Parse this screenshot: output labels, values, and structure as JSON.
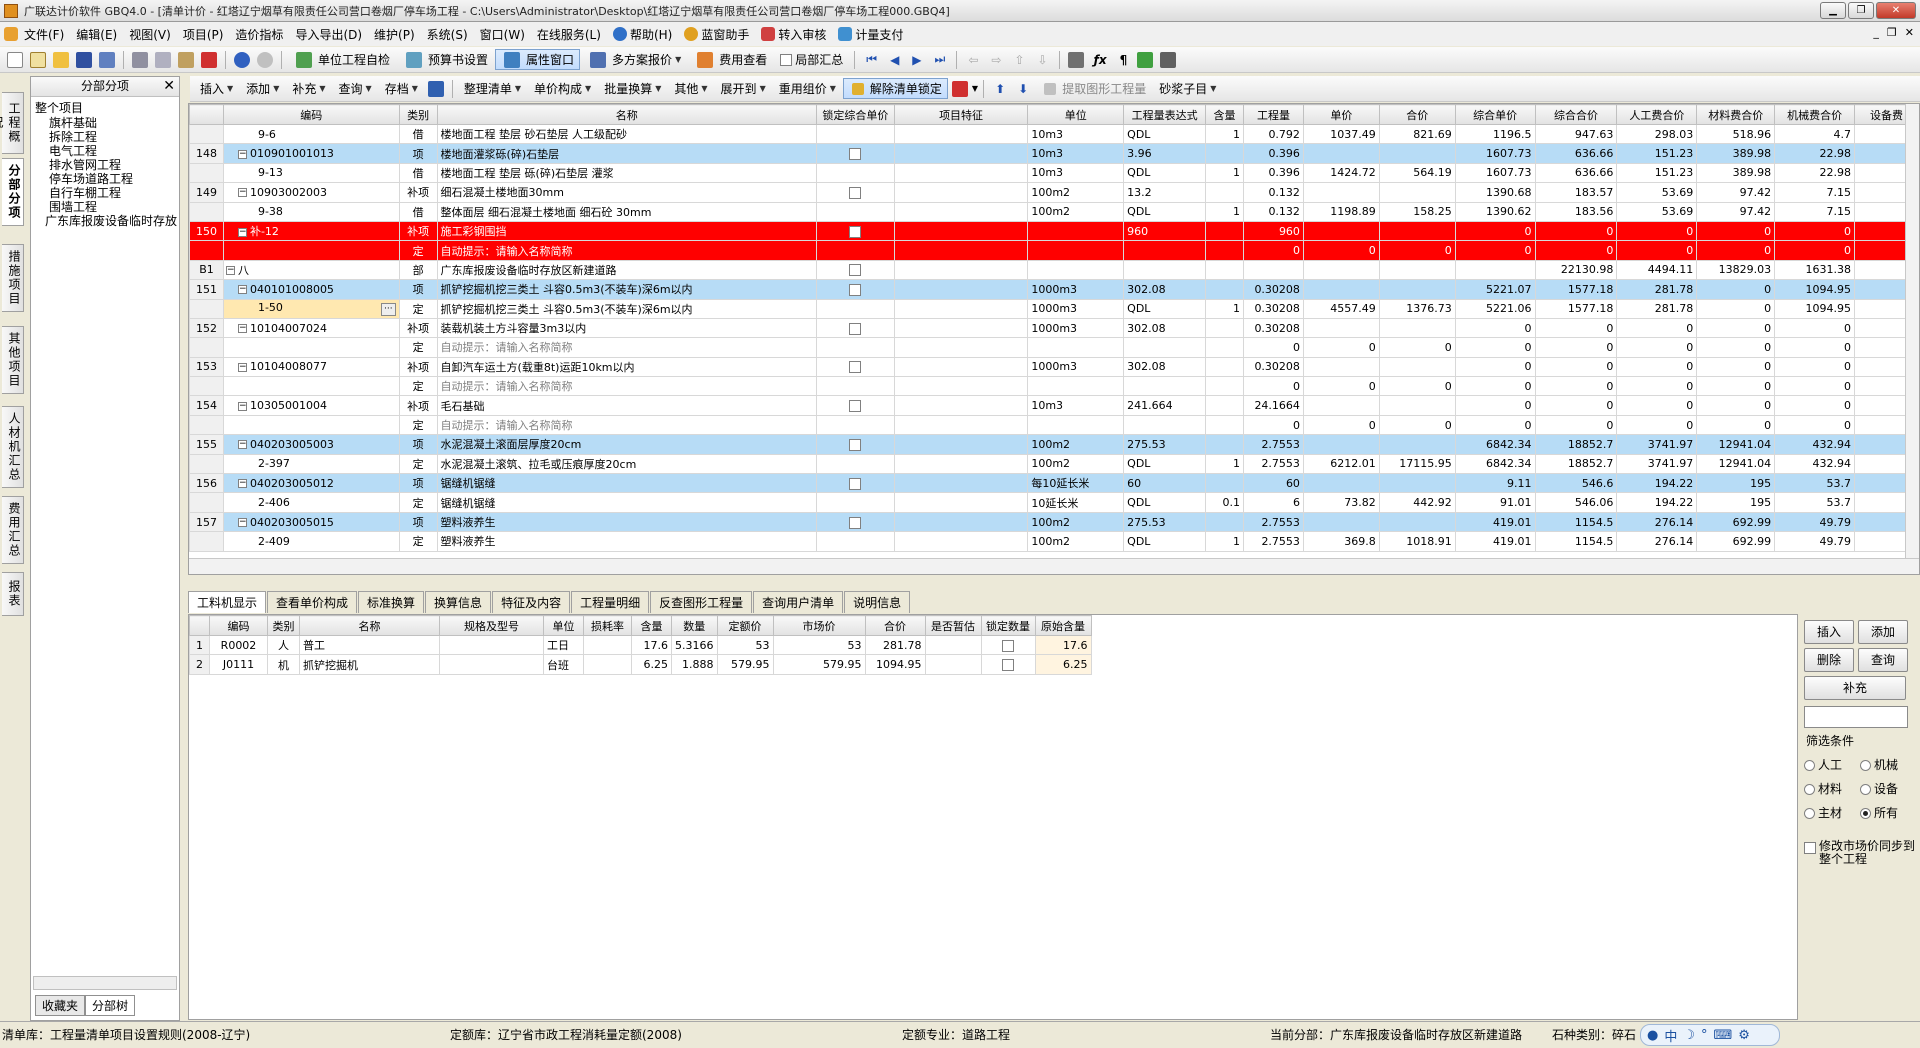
{
  "window": {
    "title": "广联达计价软件 GBQ4.0 - [清单计价 - 红塔辽宁烟草有限责任公司营口卷烟厂停车场工程 - C:\\Users\\Administrator\\Desktop\\红塔辽宁烟草有限责任公司营口卷烟厂停车场工程000.GBQ4]"
  },
  "menu": [
    "文件(F)",
    "编辑(E)",
    "视图(V)",
    "项目(P)",
    "造价指标",
    "导入导出(D)",
    "维护(P)",
    "系统(S)",
    "窗口(W)",
    "在线服务(L)",
    "帮助(H)",
    "蓝窗助手",
    "转入审核",
    "计量支付"
  ],
  "toolbar1": {
    "unit_check": "单位工程自检",
    "budget_settings": "预算书设置",
    "property_window": "属性窗口",
    "multi_plan": "多方案报价",
    "fee_view": "费用查看",
    "partial_summary": "局部汇总"
  },
  "toolbar2": [
    "插入",
    "添加",
    "补充",
    "查询",
    "存档",
    "整理清单",
    "单价构成",
    "批量换算",
    "其他",
    "展开到",
    "重用组价",
    "解除清单锁定",
    "提取图形工程量",
    "砂浆子目"
  ],
  "left_tabs": [
    "工程概况",
    "分部分项",
    "措施项目",
    "其他项目",
    "人材机汇总",
    "费用汇总",
    "报表"
  ],
  "tree": {
    "header": "分部分项",
    "root": "整个项目",
    "items": [
      "旗杆基础",
      "拆除工程",
      "电气工程",
      "排水管网工程",
      "停车场道路工程",
      "自行车棚工程",
      "围墙工程",
      "广东库报废设备临时存放"
    ],
    "tabs": [
      "收藏夹",
      "分部树"
    ]
  },
  "grid": {
    "columns": [
      "",
      "编码",
      "类别",
      "名称",
      "锁定综合单价",
      "项目特征",
      "单位",
      "工程量表达式",
      "含量",
      "工程量",
      "单价",
      "合价",
      "综合单价",
      "综合合价",
      "人工费合价",
      "材料费合价",
      "机械费合价",
      "设备费"
    ],
    "rows": [
      {
        "num": "",
        "code": "9-6",
        "type": "借",
        "name": "楼地面工程 垫层 砂石垫层 人工级配砂",
        "lock": false,
        "unit": "10m3",
        "expr": "QDL",
        "ratio": "1",
        "qty": "0.792",
        "price": "1037.49",
        "total": "821.69",
        "comp_price": "1196.5",
        "comp_total": "947.63",
        "labor": "298.03",
        "material": "518.96",
        "machine": "4.7",
        "style": "bu",
        "level": 2
      },
      {
        "num": "148",
        "code": "010901001013",
        "type": "项",
        "name": "楼地面灌浆砾(碎)石垫层",
        "lock": true,
        "unit": "10m3",
        "expr": "3.96",
        "ratio": "",
        "qty": "0.396",
        "price": "",
        "total": "",
        "comp_price": "1607.73",
        "comp_total": "636.66",
        "labor": "151.23",
        "material": "389.98",
        "machine": "22.98",
        "style": "blue",
        "level": 1
      },
      {
        "num": "",
        "code": "9-13",
        "type": "借",
        "name": "楼地面工程 垫层 砾(碎)石垫层 灌浆",
        "lock": false,
        "unit": "10m3",
        "expr": "QDL",
        "ratio": "1",
        "qty": "0.396",
        "price": "1424.72",
        "total": "564.19",
        "comp_price": "1607.73",
        "comp_total": "636.66",
        "labor": "151.23",
        "material": "389.98",
        "machine": "22.98",
        "style": "bu",
        "level": 2
      },
      {
        "num": "149",
        "code": "10903002003",
        "type": "补项",
        "name": "细石混凝土楼地面30mm",
        "lock": true,
        "unit": "100m2",
        "expr": "13.2",
        "ratio": "",
        "qty": "0.132",
        "price": "",
        "total": "",
        "comp_price": "1390.68",
        "comp_total": "183.57",
        "labor": "53.69",
        "material": "97.42",
        "machine": "7.15",
        "style": "bu",
        "level": 1
      },
      {
        "num": "",
        "code": "9-38",
        "type": "借",
        "name": "整体面层 细石混凝土楼地面 细石砼 30mm",
        "lock": false,
        "unit": "100m2",
        "expr": "QDL",
        "ratio": "1",
        "qty": "0.132",
        "price": "1198.89",
        "total": "158.25",
        "comp_price": "1390.62",
        "comp_total": "183.56",
        "labor": "53.69",
        "material": "97.42",
        "machine": "7.15",
        "style": "bu",
        "level": 2
      },
      {
        "num": "150",
        "code": "补-12",
        "type": "补项",
        "name": "施工彩钢围挡",
        "lock": true,
        "unit": "",
        "expr": "960",
        "ratio": "",
        "qty": "960",
        "price": "",
        "total": "",
        "comp_price": "0",
        "comp_total": "0",
        "labor": "0",
        "material": "0",
        "machine": "0",
        "style": "red",
        "level": 1
      },
      {
        "num": "",
        "code": "",
        "type": "定",
        "name": "自动提示：请输入名称简称",
        "lock": false,
        "unit": "",
        "expr": "",
        "ratio": "",
        "qty": "0",
        "price": "0",
        "total": "0",
        "comp_price": "0",
        "comp_total": "0",
        "labor": "0",
        "material": "0",
        "machine": "0",
        "style": "red",
        "level": 2
      },
      {
        "num": "B1",
        "code": "八",
        "type": "部",
        "name": "广东库报废设备临时存放区新建道路",
        "lock": true,
        "unit": "",
        "expr": "",
        "ratio": "",
        "qty": "",
        "price": "",
        "total": "",
        "comp_price": "",
        "comp_total": "22130.98",
        "labor": "4494.11",
        "material": "13829.03",
        "machine": "1631.38",
        "style": "bu",
        "level": 0
      },
      {
        "num": "151",
        "code": "040101008005",
        "type": "项",
        "name": "抓铲挖掘机挖三类土 斗容0.5m3(不装车)深6m以内",
        "lock": true,
        "unit": "1000m3",
        "expr": "302.08",
        "ratio": "",
        "qty": "0.30208",
        "price": "",
        "total": "",
        "comp_price": "5221.07",
        "comp_total": "1577.18",
        "labor": "281.78",
        "material": "0",
        "machine": "1094.95",
        "style": "blue",
        "level": 1
      },
      {
        "num": "",
        "code": "1-50",
        "type": "定",
        "name": "抓铲挖掘机挖三类土 斗容0.5m3(不装车)深6m以内",
        "lock": false,
        "unit": "1000m3",
        "expr": "QDL",
        "ratio": "1",
        "qty": "0.30208",
        "price": "4557.49",
        "total": "1376.73",
        "comp_price": "5221.06",
        "comp_total": "1577.18",
        "labor": "281.78",
        "material": "0",
        "machine": "1094.95",
        "style": "bu",
        "level": 2,
        "selected": true
      },
      {
        "num": "152",
        "code": "10104007024",
        "type": "补项",
        "name": "装载机装土方斗容量3m3以内",
        "lock": true,
        "unit": "1000m3",
        "expr": "302.08",
        "ratio": "",
        "qty": "0.30208",
        "price": "",
        "total": "",
        "comp_price": "0",
        "comp_total": "0",
        "labor": "0",
        "material": "0",
        "machine": "0",
        "style": "bu",
        "level": 1
      },
      {
        "num": "",
        "code": "",
        "type": "定",
        "name": "自动提示：请输入名称简称",
        "lock": false,
        "unit": "",
        "expr": "",
        "ratio": "",
        "qty": "0",
        "price": "0",
        "total": "0",
        "comp_price": "0",
        "comp_total": "0",
        "labor": "0",
        "material": "0",
        "machine": "0",
        "style": "bu",
        "level": 2,
        "hint": true
      },
      {
        "num": "153",
        "code": "10104008077",
        "type": "补项",
        "name": "自卸汽车运土方(载重8t)运距10km以内",
        "lock": true,
        "unit": "1000m3",
        "expr": "302.08",
        "ratio": "",
        "qty": "0.30208",
        "price": "",
        "total": "",
        "comp_price": "0",
        "comp_total": "0",
        "labor": "0",
        "material": "0",
        "machine": "0",
        "style": "bu",
        "level": 1
      },
      {
        "num": "",
        "code": "",
        "type": "定",
        "name": "自动提示：请输入名称简称",
        "lock": false,
        "unit": "",
        "expr": "",
        "ratio": "",
        "qty": "0",
        "price": "0",
        "total": "0",
        "comp_price": "0",
        "comp_total": "0",
        "labor": "0",
        "material": "0",
        "machine": "0",
        "style": "bu",
        "level": 2,
        "hint": true
      },
      {
        "num": "154",
        "code": "10305001004",
        "type": "补项",
        "name": "毛石基础",
        "lock": true,
        "unit": "10m3",
        "expr": "241.664",
        "ratio": "",
        "qty": "24.1664",
        "price": "",
        "total": "",
        "comp_price": "0",
        "comp_total": "0",
        "labor": "0",
        "material": "0",
        "machine": "0",
        "style": "bu",
        "level": 1
      },
      {
        "num": "",
        "code": "",
        "type": "定",
        "name": "自动提示：请输入名称简称",
        "lock": false,
        "unit": "",
        "expr": "",
        "ratio": "",
        "qty": "0",
        "price": "0",
        "total": "0",
        "comp_price": "0",
        "comp_total": "0",
        "labor": "0",
        "material": "0",
        "machine": "0",
        "style": "bu",
        "level": 2,
        "hint": true
      },
      {
        "num": "155",
        "code": "040203005003",
        "type": "项",
        "name": "水泥混凝土滚面层厚度20cm",
        "lock": true,
        "unit": "100m2",
        "expr": "275.53",
        "ratio": "",
        "qty": "2.7553",
        "price": "",
        "total": "",
        "comp_price": "6842.34",
        "comp_total": "18852.7",
        "labor": "3741.97",
        "material": "12941.04",
        "machine": "432.94",
        "style": "blue",
        "level": 1
      },
      {
        "num": "",
        "code": "2-397",
        "type": "定",
        "name": "水泥混凝土滚筑、拉毛或压痕厚度20cm",
        "lock": false,
        "unit": "100m2",
        "expr": "QDL",
        "ratio": "1",
        "qty": "2.7553",
        "price": "6212.01",
        "total": "17115.95",
        "comp_price": "6842.34",
        "comp_total": "18852.7",
        "labor": "3741.97",
        "material": "12941.04",
        "machine": "432.94",
        "style": "bu",
        "level": 2
      },
      {
        "num": "156",
        "code": "040203005012",
        "type": "项",
        "name": "锯缝机锯缝",
        "lock": true,
        "unit": "每10延长米",
        "expr": "60",
        "ratio": "",
        "qty": "60",
        "price": "",
        "total": "",
        "comp_price": "9.11",
        "comp_total": "546.6",
        "labor": "194.22",
        "material": "195",
        "machine": "53.7",
        "style": "blue",
        "level": 1
      },
      {
        "num": "",
        "code": "2-406",
        "type": "定",
        "name": "锯缝机锯缝",
        "lock": false,
        "unit": "10延长米",
        "expr": "QDL",
        "ratio": "0.1",
        "qty": "6",
        "price": "73.82",
        "total": "442.92",
        "comp_price": "91.01",
        "comp_total": "546.06",
        "labor": "194.22",
        "material": "195",
        "machine": "53.7",
        "style": "bu",
        "level": 2
      },
      {
        "num": "157",
        "code": "040203005015",
        "type": "项",
        "name": "塑料液养生",
        "lock": true,
        "unit": "100m2",
        "expr": "275.53",
        "ratio": "",
        "qty": "2.7553",
        "price": "",
        "total": "",
        "comp_price": "419.01",
        "comp_total": "1154.5",
        "labor": "276.14",
        "material": "692.99",
        "machine": "49.79",
        "style": "blue",
        "level": 1
      },
      {
        "num": "",
        "code": "2-409",
        "type": "定",
        "name": "塑料液养生",
        "lock": false,
        "unit": "100m2",
        "expr": "QDL",
        "ratio": "1",
        "qty": "2.7553",
        "price": "369.8",
        "total": "1018.91",
        "comp_price": "419.01",
        "comp_total": "1154.5",
        "labor": "276.14",
        "material": "692.99",
        "machine": "49.79",
        "style": "bu",
        "level": 2
      }
    ]
  },
  "bottom_tabs": [
    "工料机显示",
    "查看单价构成",
    "标准换算",
    "换算信息",
    "特征及内容",
    "工程量明细",
    "反查图形工程量",
    "查询用户清单",
    "说明信息"
  ],
  "sub_grid": {
    "columns": [
      "",
      "编码",
      "类别",
      "名称",
      "规格及型号",
      "单位",
      "损耗率",
      "含量",
      "数量",
      "定额价",
      "市场价",
      "合价",
      "是否暂估",
      "锁定数量",
      "原始含量"
    ],
    "rows": [
      {
        "num": "1",
        "code": "R0002",
        "type": "人",
        "name": "普工",
        "spec": "",
        "unit": "工日",
        "loss": "",
        "ratio": "17.6",
        "qty": "5.3166",
        "quota": "53",
        "market": "53",
        "total": "281.78",
        "est": "",
        "lock": false,
        "orig": "17.6"
      },
      {
        "num": "2",
        "code": "J0111",
        "type": "机",
        "name": "抓铲挖掘机",
        "spec": "",
        "unit": "台班",
        "loss": "",
        "ratio": "6.25",
        "qty": "1.888",
        "quota": "579.95",
        "market": "579.95",
        "total": "1094.95",
        "est": "",
        "lock": false,
        "orig": "6.25"
      }
    ]
  },
  "right_panel": {
    "insert": "插入",
    "add": "添加",
    "delete": "删除",
    "query": "查询",
    "supplement": "补充",
    "filter_title": "筛选条件",
    "filters": [
      {
        "label": "人工",
        "checked": false
      },
      {
        "label": "机械",
        "checked": false
      },
      {
        "label": "材料",
        "checked": false
      },
      {
        "label": "设备",
        "checked": false
      },
      {
        "label": "主材",
        "checked": false
      },
      {
        "label": "所有",
        "checked": true
      }
    ],
    "sync_label": "修改市场价同步到整个工程"
  },
  "status": {
    "list_lib": "清单库：工程量清单项目设置规则(2008-辽宁)",
    "quota_lib": "定额库：辽宁省市政工程消耗量定额(2008)",
    "quota_major": "定额专业：道路工程",
    "current_section": "当前分部：广东库报废设备临时存放区新建道路",
    "stone_type": "石种类别：碎石"
  },
  "colors": {
    "row_blue": "#b7dcf6",
    "row_red": "#ff0000",
    "header": "#e2e2e2"
  }
}
